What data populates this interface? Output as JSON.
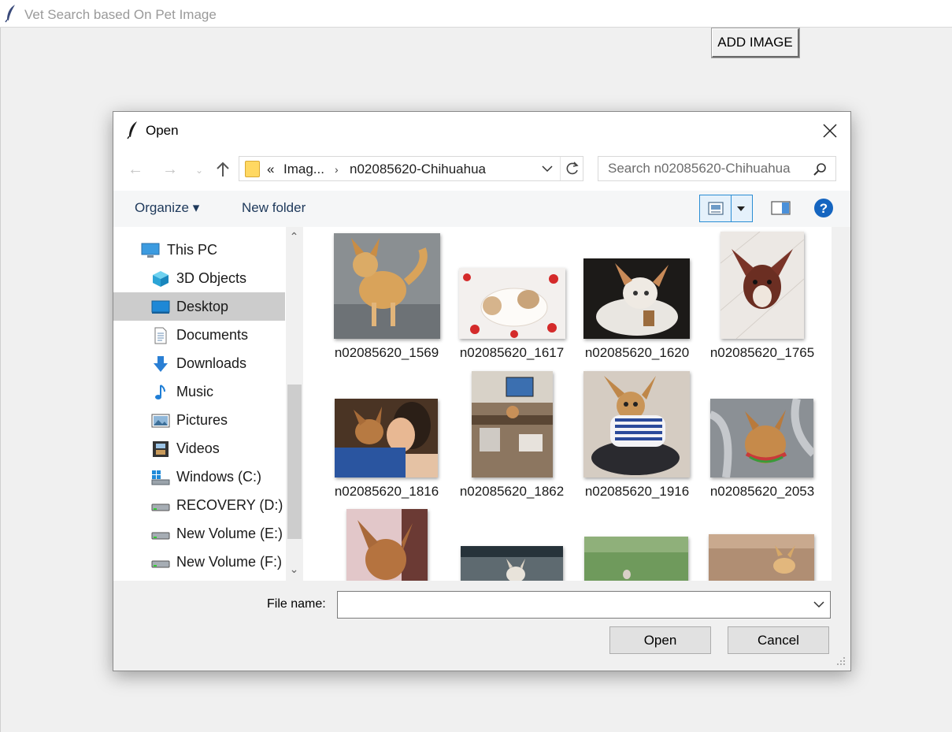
{
  "window": {
    "title": "Vet Search based On Pet Image",
    "add_button": "ADD IMAGE"
  },
  "dialog": {
    "title": "Open",
    "address": {
      "prefix": "«",
      "crumbs": [
        "Imag...",
        "n02085620-Chihuahua"
      ]
    },
    "search_placeholder": "Search n02085620-Chihuahua",
    "toolbar": {
      "organize": "Organize ▾",
      "new_folder": "New folder"
    },
    "nav": [
      {
        "label": "This PC",
        "icon": "computer-icon"
      },
      {
        "label": "3D Objects",
        "icon": "cube-icon"
      },
      {
        "label": "Desktop",
        "icon": "desktop-icon",
        "selected": true
      },
      {
        "label": "Documents",
        "icon": "document-icon"
      },
      {
        "label": "Downloads",
        "icon": "download-arrow-icon"
      },
      {
        "label": "Music",
        "icon": "music-note-icon"
      },
      {
        "label": "Pictures",
        "icon": "picture-icon"
      },
      {
        "label": "Videos",
        "icon": "film-icon"
      },
      {
        "label": "Windows (C:)",
        "icon": "windows-drive-icon"
      },
      {
        "label": "RECOVERY (D:)",
        "icon": "drive-icon"
      },
      {
        "label": "New Volume (E:)",
        "icon": "drive-icon"
      },
      {
        "label": "New Volume (F:)",
        "icon": "drive-icon"
      }
    ],
    "files": [
      {
        "name": "n02085620_1569"
      },
      {
        "name": "n02085620_1617"
      },
      {
        "name": "n02085620_1620"
      },
      {
        "name": "n02085620_1765"
      },
      {
        "name": "n02085620_1816"
      },
      {
        "name": "n02085620_1862"
      },
      {
        "name": "n02085620_1916"
      },
      {
        "name": "n02085620_2053"
      },
      {
        "name": ""
      },
      {
        "name": ""
      },
      {
        "name": ""
      },
      {
        "name": ""
      }
    ],
    "file_name_label": "File name:",
    "file_name_value": "",
    "open_button": "Open",
    "cancel_button": "Cancel"
  },
  "colors": {
    "accent_blue": "#2a8dd4",
    "folder_yellow": "#ffd862",
    "selected_nav": "#cccccc",
    "help_blue": "#1565c0"
  }
}
